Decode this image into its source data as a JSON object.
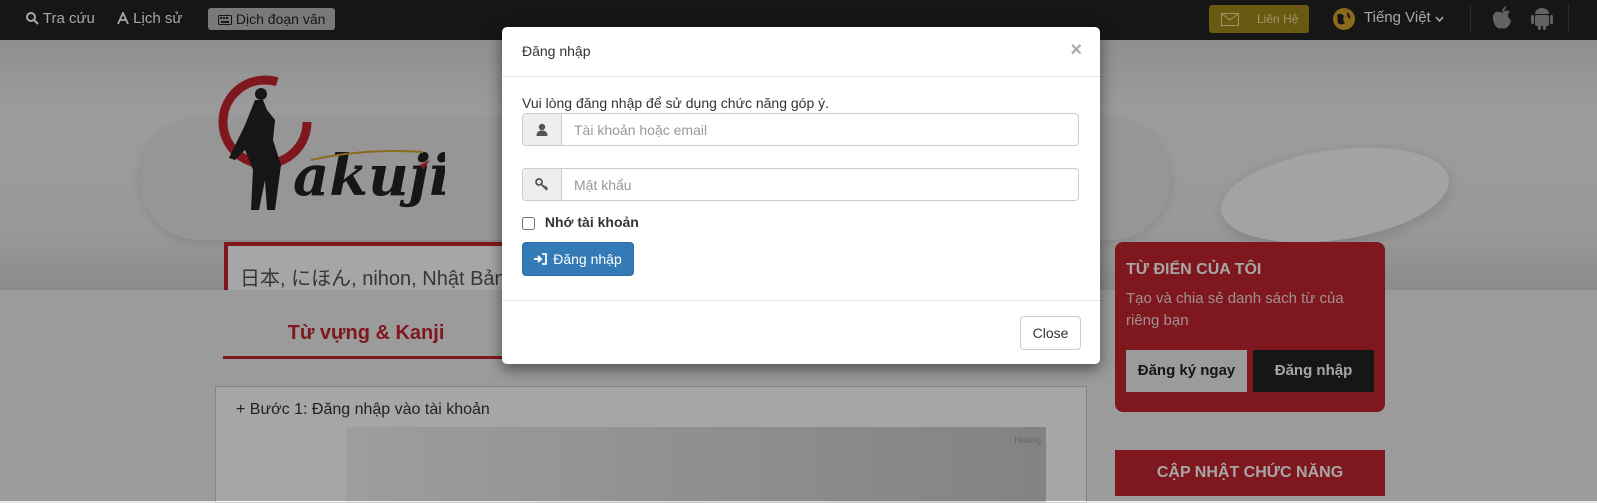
{
  "topbar": {
    "tra_cuu": "Tra cứu",
    "lich_su": "Lịch sử",
    "dich_doan_van": "Dịch đoạn văn",
    "lien_he": "Liên Hệ",
    "language": "Tiếng Việt",
    "icons": [
      "search-icon",
      "font-icon",
      "keyboard-icon",
      "mail-icon",
      "globe-icon",
      "chevron-down-icon",
      "apple-icon",
      "android-icon"
    ]
  },
  "search": {
    "placeholder": "日本, にほん, nihon, Nhật Bản"
  },
  "tabs": {
    "tu_vung": "Từ vựng & Kanji"
  },
  "guide": {
    "step1": "+ Bước 1: Đăng nhập vào tài khoản",
    "screenshot_user": "Hoang"
  },
  "sidebar": {
    "title": "TỪ ĐIỂN CỦA TÔI",
    "description": "Tạo và chia sẻ danh sách từ của riêng bạn",
    "register": "Đăng ký ngay",
    "login": "Đăng nhập",
    "update": "CẬP NHẬT CHỨC NĂNG"
  },
  "modal": {
    "title": "Đăng nhập",
    "close_x": "×",
    "message": "Vui lòng đăng nhập để sử dụng chức năng góp ý.",
    "username_placeholder": "Tài khoản hoặc email",
    "password_placeholder": "Mật khẩu",
    "remember": "Nhớ tài khoản",
    "login_button": "Đăng nhập",
    "close_button": "Close"
  },
  "colors": {
    "brand_red": "#c4262e",
    "primary_blue": "#337ab7",
    "topbar": "#222222"
  }
}
